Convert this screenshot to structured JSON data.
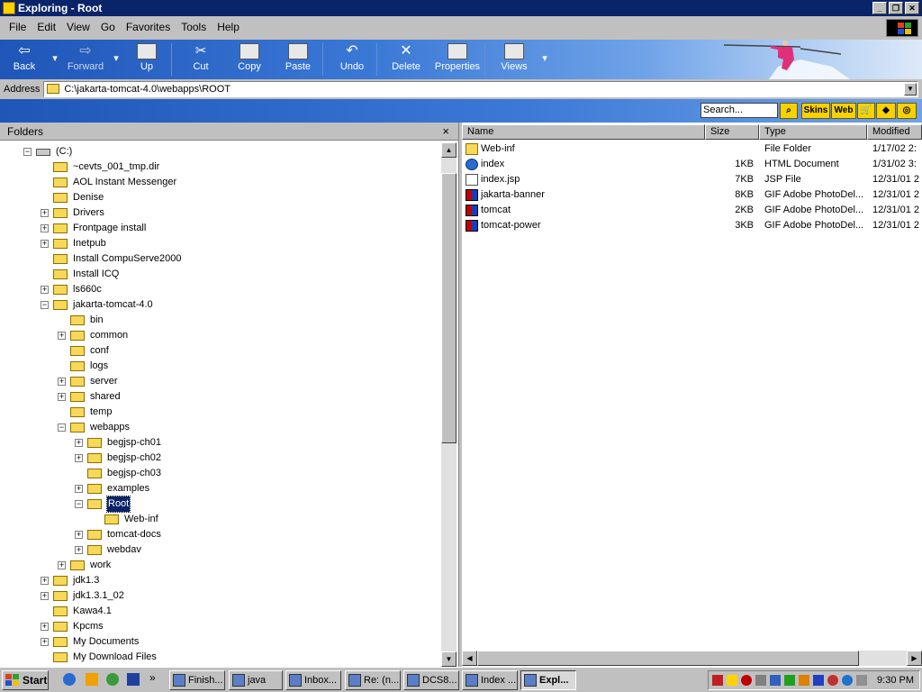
{
  "window": {
    "title": "Exploring - Root"
  },
  "menu": [
    "File",
    "Edit",
    "View",
    "Go",
    "Favorites",
    "Tools",
    "Help"
  ],
  "toolbar": {
    "back": "Back",
    "forward": "Forward",
    "up": "Up",
    "cut": "Cut",
    "copy": "Copy",
    "paste": "Paste",
    "undo": "Undo",
    "delete": "Delete",
    "properties": "Properties",
    "views": "Views"
  },
  "address": {
    "label": "Address",
    "value": "C:\\jakarta-tomcat-4.0\\webapps\\ROOT"
  },
  "search": {
    "placeholder": "Search...",
    "skins": "Skins",
    "web": "Web"
  },
  "folders": {
    "title": "Folders",
    "close": "×",
    "tree": [
      {
        "label": "(C:)",
        "level": 0,
        "exp": "-",
        "drive": true
      },
      {
        "label": "~cevts_001_tmp.dir",
        "level": 1,
        "exp": ""
      },
      {
        "label": "AOL Instant Messenger",
        "level": 1,
        "exp": ""
      },
      {
        "label": "Denise",
        "level": 1,
        "exp": ""
      },
      {
        "label": "Drivers",
        "level": 1,
        "exp": "+"
      },
      {
        "label": "Frontpage install",
        "level": 1,
        "exp": "+"
      },
      {
        "label": "Inetpub",
        "level": 1,
        "exp": "+"
      },
      {
        "label": "Install CompuServe2000",
        "level": 1,
        "exp": ""
      },
      {
        "label": "Install ICQ",
        "level": 1,
        "exp": ""
      },
      {
        "label": "ls660c",
        "level": 1,
        "exp": "+"
      },
      {
        "label": "jakarta-tomcat-4.0",
        "level": 1,
        "exp": "-"
      },
      {
        "label": "bin",
        "level": 2,
        "exp": ""
      },
      {
        "label": "common",
        "level": 2,
        "exp": "+"
      },
      {
        "label": "conf",
        "level": 2,
        "exp": ""
      },
      {
        "label": "logs",
        "level": 2,
        "exp": ""
      },
      {
        "label": "server",
        "level": 2,
        "exp": "+"
      },
      {
        "label": "shared",
        "level": 2,
        "exp": "+"
      },
      {
        "label": "temp",
        "level": 2,
        "exp": ""
      },
      {
        "label": "webapps",
        "level": 2,
        "exp": "-"
      },
      {
        "label": "begjsp-ch01",
        "level": 3,
        "exp": "+"
      },
      {
        "label": "begjsp-ch02",
        "level": 3,
        "exp": "+"
      },
      {
        "label": "begjsp-ch03",
        "level": 3,
        "exp": ""
      },
      {
        "label": "examples",
        "level": 3,
        "exp": "+"
      },
      {
        "label": "Root",
        "level": 3,
        "exp": "-",
        "selected": true
      },
      {
        "label": "Web-inf",
        "level": 4,
        "exp": ""
      },
      {
        "label": "tomcat-docs",
        "level": 3,
        "exp": "+"
      },
      {
        "label": "webdav",
        "level": 3,
        "exp": "+"
      },
      {
        "label": "work",
        "level": 2,
        "exp": "+"
      },
      {
        "label": "jdk1.3",
        "level": 1,
        "exp": "+"
      },
      {
        "label": "jdk1.3.1_02",
        "level": 1,
        "exp": "+"
      },
      {
        "label": "Kawa4.1",
        "level": 1,
        "exp": ""
      },
      {
        "label": "Kpcms",
        "level": 1,
        "exp": "+"
      },
      {
        "label": "My Documents",
        "level": 1,
        "exp": "+"
      },
      {
        "label": "My Download Files",
        "level": 1,
        "exp": ""
      }
    ]
  },
  "files": {
    "columns": [
      "Name",
      "Size",
      "Type",
      "Modified"
    ],
    "rows": [
      {
        "name": "Web-inf",
        "size": "",
        "type": "File Folder",
        "modified": "1/17/02 2:",
        "icon": "folder"
      },
      {
        "name": "index",
        "size": "1KB",
        "type": "HTML Document",
        "modified": "1/31/02 3:",
        "icon": "html"
      },
      {
        "name": "index.jsp",
        "size": "7KB",
        "type": "JSP File",
        "modified": "12/31/01 2",
        "icon": "jsp"
      },
      {
        "name": "jakarta-banner",
        "size": "8KB",
        "type": "GIF Adobe PhotoDel...",
        "modified": "12/31/01 2",
        "icon": "gif"
      },
      {
        "name": "tomcat",
        "size": "2KB",
        "type": "GIF Adobe PhotoDel...",
        "modified": "12/31/01 2",
        "icon": "gif"
      },
      {
        "name": "tomcat-power",
        "size": "3KB",
        "type": "GIF Adobe PhotoDel...",
        "modified": "12/31/01 2",
        "icon": "gif"
      }
    ]
  },
  "taskbar": {
    "start": "Start",
    "more": "»",
    "buttons": [
      "Finish...",
      "java",
      "Inbox...",
      "Re: (n...",
      "DCS8...",
      "Index ...",
      "Expl..."
    ],
    "clock": "9:30 PM"
  },
  "colors": {
    "title": "#0a246a",
    "toolbar": "#3a78d6",
    "folder": "#f8d858"
  }
}
